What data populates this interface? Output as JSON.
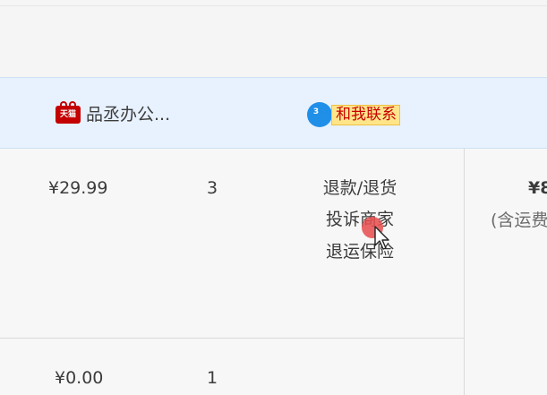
{
  "shop": {
    "badge_text": "天猫",
    "name": "品丞办公...",
    "chat_count": "3",
    "contact_label": "和我联系"
  },
  "orders": [
    {
      "price": "¥29.99",
      "quantity": "3",
      "operations": [
        "退款/退货",
        "投诉商家",
        "退运保险"
      ]
    },
    {
      "price": "¥0.00",
      "quantity": "1"
    }
  ],
  "summary": {
    "total_partial": "¥8",
    "shipping_note_partial": "(含运费"
  },
  "colors": {
    "header_bg": "#e8f2ff",
    "tmall_red": "#c40000",
    "chat_blue": "#1f8fe8",
    "contact_bg": "#ffe58a",
    "contact_text": "#c80000",
    "click_marker": "#e74c4c"
  },
  "icons": {
    "tmall": "tmall-icon",
    "chat": "wangwang-chat-icon",
    "cursor": "mouse-cursor-icon"
  }
}
